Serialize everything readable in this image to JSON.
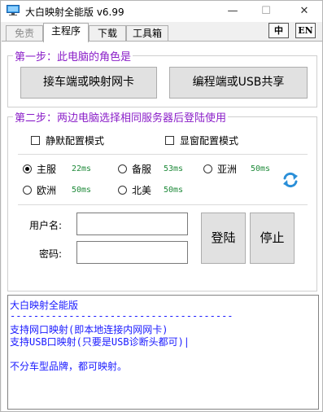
{
  "titlebar": {
    "title": "大白映射全能版 v6.99",
    "minimize_glyph": "—",
    "maximize_glyph": "☐",
    "close_glyph": "✕",
    "icon": "monitor-icon"
  },
  "tabs": [
    {
      "label": "免责",
      "state": "disabled"
    },
    {
      "label": "主程序",
      "state": "active"
    },
    {
      "label": "下载",
      "state": "normal"
    },
    {
      "label": "工具箱",
      "state": "normal"
    }
  ],
  "lang": {
    "zh_label": "中",
    "en_label": "EN"
  },
  "step1": {
    "title": "第一步：此电脑的角色是",
    "car_button": "接车端或映射网卡",
    "prog_button": "编程端或USB共享"
  },
  "step2": {
    "title": "第二步：两边电脑选择相同服务器后登陆使用",
    "silent_mode": "静默配置模式",
    "window_mode": "显窗配置模式",
    "servers": [
      {
        "label": "主服",
        "ping": "22ms",
        "selected": true
      },
      {
        "label": "备服",
        "ping": "53ms",
        "selected": false
      },
      {
        "label": "亚洲",
        "ping": "50ms",
        "selected": false
      },
      {
        "label": "欧洲",
        "ping": "50ms",
        "selected": false
      },
      {
        "label": "北美",
        "ping": "50ms",
        "selected": false
      }
    ],
    "refresh_icon": "refresh-icon",
    "username_label": "用户名:",
    "username_value": "",
    "password_label": "密码:",
    "password_value": "",
    "login_button": "登陆",
    "stop_button": "停止"
  },
  "log": {
    "lines": [
      "大白映射全能版",
      "--------------------------------------",
      "支持网口映射(即本地连接内网网卡)",
      "支持USB口映射(只要是USB诊断头都可)|",
      "",
      "不分车型品牌，都可映射。"
    ]
  },
  "colors": {
    "group_title": "#8a1ec8",
    "ping": "#1f8a3a",
    "log_text": "#1a1aff"
  }
}
